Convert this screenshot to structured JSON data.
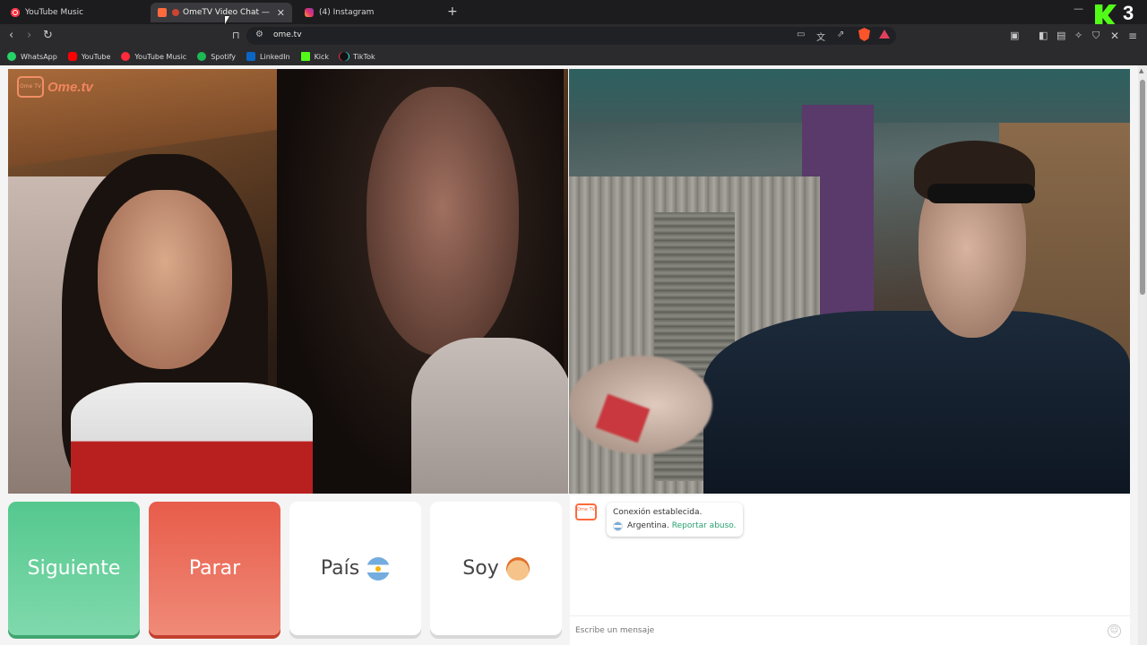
{
  "tabs": [
    {
      "label": "YouTube Music",
      "active": false
    },
    {
      "label": "OmeTV Video Chat — Omegle",
      "active": true
    },
    {
      "label": "(4) Instagram",
      "active": false
    }
  ],
  "address_bar": {
    "url": "ome.tv"
  },
  "overlay": {
    "kick_count": "3"
  },
  "bookmarks": [
    {
      "label": "WhatsApp"
    },
    {
      "label": "YouTube"
    },
    {
      "label": "YouTube Music"
    },
    {
      "label": "Spotify"
    },
    {
      "label": "LinkedIn"
    },
    {
      "label": "Kick"
    },
    {
      "label": "TikTok"
    }
  ],
  "video": {
    "logo_small": "Ome TV",
    "logo_text": "Ome.tv"
  },
  "controls": {
    "next_label": "Siguiente",
    "stop_label": "Parar",
    "country_label": "País",
    "gender_label": "Soy"
  },
  "chat": {
    "logo_small": "Ome TV",
    "status": "Conexión establecida.",
    "country": "Argentina.",
    "report_label": "Reportar abuso.",
    "input_placeholder": "Escribe un mensaje"
  },
  "colors": {
    "next_button": "#55c88e",
    "stop_button": "#e85c4a",
    "report_link": "#2aa070",
    "brand": "#ff6a3d"
  }
}
